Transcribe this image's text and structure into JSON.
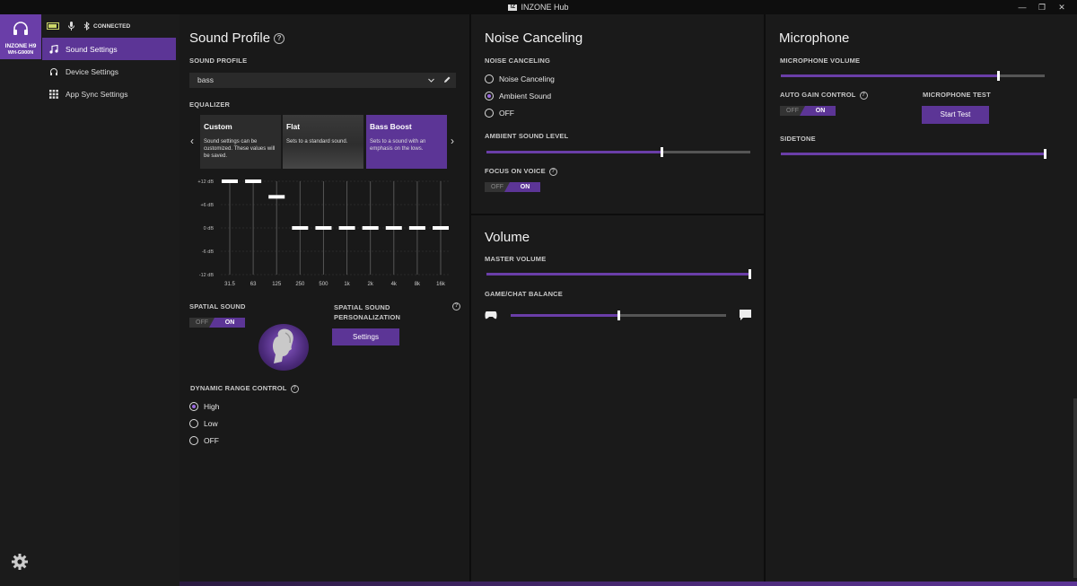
{
  "titlebar": {
    "title": "INZONE Hub",
    "logo_text": "IZ"
  },
  "device": {
    "name1": "INZONE H9",
    "name2": "WH-G900N",
    "status": "CONNECTED"
  },
  "nav": [
    {
      "label": "Sound Settings",
      "active": true
    },
    {
      "label": "Device Settings",
      "active": false
    },
    {
      "label": "App Sync Settings",
      "active": false
    }
  ],
  "sound_profile": {
    "title": "Sound Profile",
    "profile_label": "SOUND PROFILE",
    "profile_value": "bass",
    "eq_label": "EQUALIZER",
    "presets": [
      {
        "title": "Custom",
        "desc": "Sound settings can be customized. These values will be saved."
      },
      {
        "title": "Flat",
        "desc": "Sets to a standard sound."
      },
      {
        "title": "Bass Boost",
        "desc": "Sets to a sound with an emphasis on the lows."
      }
    ],
    "eq": {
      "db_labels": [
        "+12 dB",
        "+6 dB",
        "0 dB",
        "-6 dB",
        "-12 dB"
      ],
      "bands": [
        "31.5",
        "63",
        "125",
        "250",
        "500",
        "1k",
        "2k",
        "4k",
        "8k",
        "16k"
      ],
      "values": [
        12,
        12,
        8,
        0,
        0,
        0,
        0,
        0,
        0,
        0
      ]
    },
    "spatial_label": "SPATIAL SOUND",
    "spatial_toggle": {
      "off": "OFF",
      "on": "ON"
    },
    "personalization_label_1": "SPATIAL SOUND",
    "personalization_label_2": "PERSONALIZATION",
    "settings_button": "Settings",
    "drc_label": "DYNAMIC RANGE CONTROL",
    "drc_options": [
      "High",
      "Low",
      "OFF"
    ],
    "drc_selected": 0
  },
  "noise": {
    "title": "Noise Canceling",
    "label": "NOISE CANCELING",
    "options": [
      "Noise Canceling",
      "Ambient Sound",
      "OFF"
    ],
    "selected": 1,
    "ambient_label": "AMBIENT SOUND LEVEL",
    "ambient_level": 0.66,
    "focus_label": "FOCUS ON VOICE",
    "focus_toggle": {
      "off": "OFF",
      "on": "ON"
    }
  },
  "volume": {
    "title": "Volume",
    "master_label": "MASTER VOLUME",
    "master_level": 1.0,
    "balance_label": "GAME/CHAT BALANCE",
    "balance_level": 0.5
  },
  "mic": {
    "title": "Microphone",
    "volume_label": "MICROPHONE VOLUME",
    "volume_level": 0.82,
    "agc_label": "AUTO GAIN CONTROL",
    "agc_toggle": {
      "off": "OFF",
      "on": "ON"
    },
    "test_label": "MICROPHONE TEST",
    "test_button": "Start Test",
    "sidetone_label": "SIDETONE",
    "sidetone_level": 1.0
  },
  "colors": {
    "accent": "#5c3596",
    "accent_light": "#9a6ae0",
    "background": "#181818"
  }
}
